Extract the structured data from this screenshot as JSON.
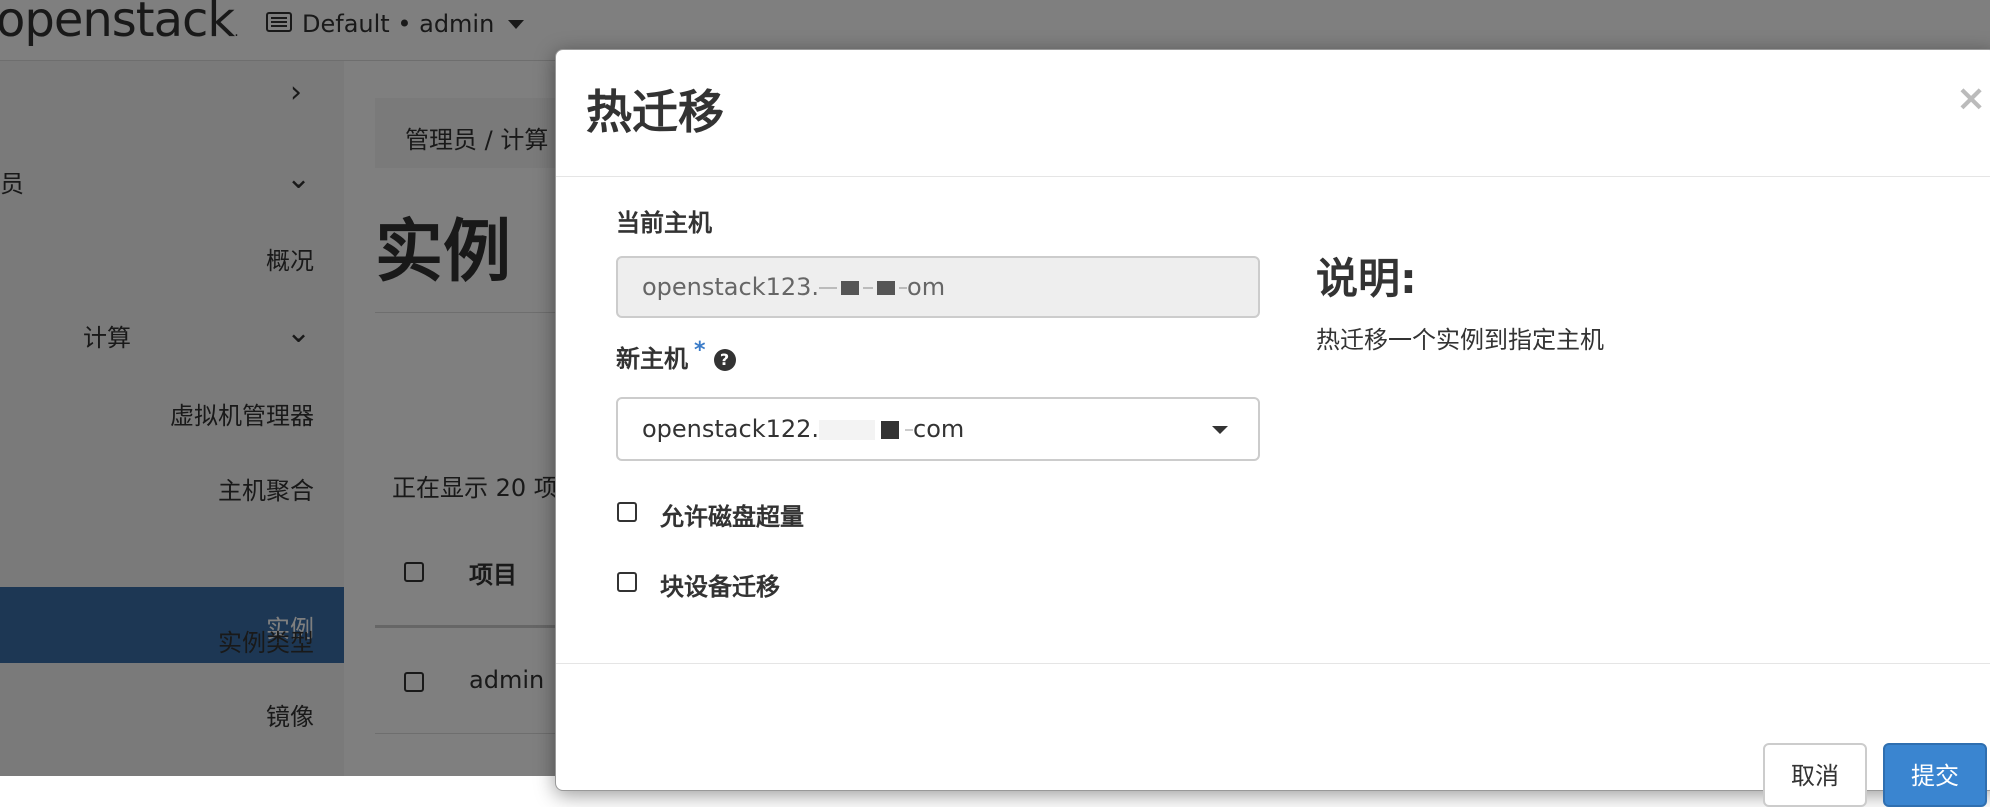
{
  "topbar": {
    "logo": "openstack",
    "project_selector": "Default • admin"
  },
  "sidebar": {
    "items": [
      {
        "label": "员"
      },
      {
        "label": "概况"
      },
      {
        "label": "计算"
      },
      {
        "label": "虚拟机管理器"
      },
      {
        "label": "主机聚合"
      },
      {
        "label": "实例"
      },
      {
        "label": "实例类型"
      },
      {
        "label": "镜像"
      }
    ]
  },
  "page": {
    "breadcrumb": "管理员 /  计算",
    "title": "实例",
    "showing": "正在显示 20 项",
    "table_header": "项目",
    "row_project": "admin"
  },
  "modal": {
    "title": "热迁移",
    "close": "×",
    "current_host_label": "当前主机",
    "current_host_value": "openstack123.",
    "current_host_suffix": "om",
    "new_host_label": "新主机",
    "required_mark": "*",
    "help_icon": "?",
    "new_host_value": "openstack122.",
    "new_host_suffix": "com",
    "disk_overcommit_label": "允许磁盘超量",
    "block_migration_label": "块设备迁移",
    "description_title": "说明:",
    "description_text": "热迁移一个实例到指定主机",
    "cancel_button": "取消",
    "submit_button": "提交"
  }
}
